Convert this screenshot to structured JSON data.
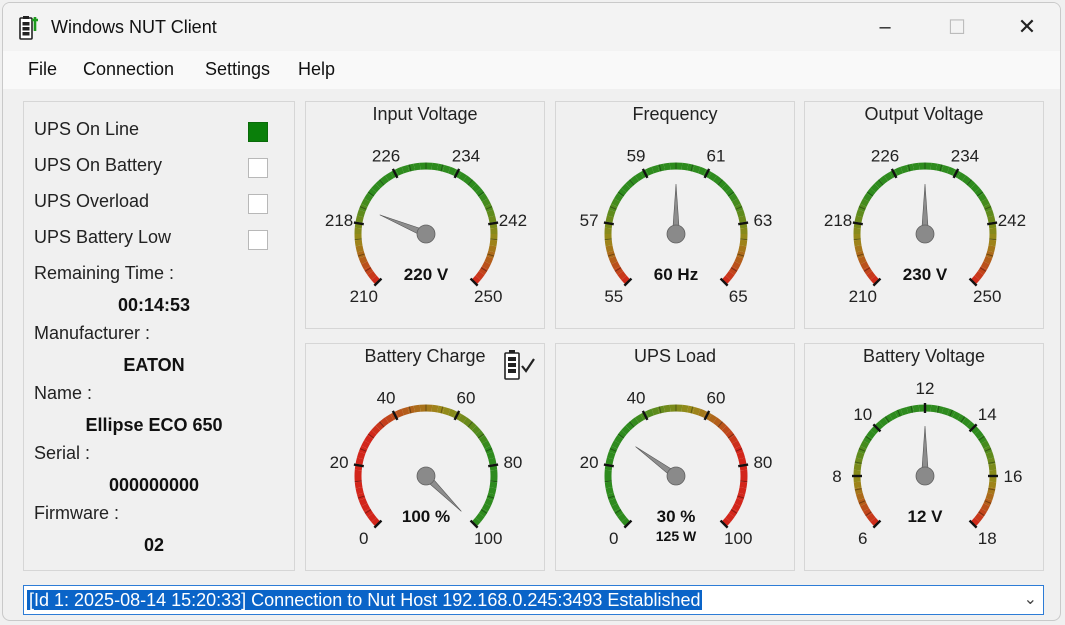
{
  "window": {
    "title": "Windows NUT Client"
  },
  "titlebar": {
    "minimize": "–",
    "maximize": "☐",
    "close": "✕"
  },
  "menu": [
    "File",
    "Connection",
    "Settings",
    "Help"
  ],
  "status": {
    "items": [
      {
        "label": "UPS On Line",
        "on": true
      },
      {
        "label": "UPS On Battery",
        "on": false
      },
      {
        "label": "UPS Overload",
        "on": false
      },
      {
        "label": "UPS Battery Low",
        "on": false
      }
    ]
  },
  "info": {
    "remaining_label": "Remaining Time :",
    "remaining_value": "00:14:53",
    "manufacturer_label": "Manufacturer :",
    "manufacturer_value": "EATON",
    "name_label": "Name :",
    "name_value": "Ellipse ECO 650",
    "serial_label": "Serial :",
    "serial_value": "000000000",
    "firmware_label": "Firmware :",
    "firmware_value": "02"
  },
  "colors": {
    "green": "#2e8b1e",
    "yellow": "#9a8a1a",
    "red": "#d2261b",
    "online": "#0a7f0a"
  },
  "gauges": [
    {
      "id": "input-voltage",
      "title": "Input Voltage",
      "min": 210,
      "max": 250,
      "labels": [
        "210",
        "218",
        "226",
        "234",
        "242",
        "250"
      ],
      "value": 220,
      "readout": "220 V",
      "subreadout": "",
      "zones": "ggr",
      "battery_icon": false
    },
    {
      "id": "frequency",
      "title": "Frequency",
      "min": 55,
      "max": 65,
      "labels": [
        "55",
        "57",
        "59",
        "61",
        "63",
        "65"
      ],
      "value": 60,
      "readout": "60 Hz",
      "subreadout": "",
      "zones": "ggr",
      "battery_icon": false
    },
    {
      "id": "output-voltage",
      "title": "Output Voltage",
      "min": 210,
      "max": 250,
      "labels": [
        "210",
        "218",
        "226",
        "234",
        "242",
        "250"
      ],
      "value": 230,
      "readout": "230 V",
      "subreadout": "",
      "zones": "ggr",
      "battery_icon": false
    },
    {
      "id": "battery-charge",
      "title": "Battery Charge",
      "min": 0,
      "max": 100,
      "labels": [
        "0",
        "20",
        "40",
        "60",
        "80",
        "100"
      ],
      "value": 100,
      "readout": "100 %",
      "subreadout": "",
      "zones": "rg",
      "battery_icon": true
    },
    {
      "id": "ups-load",
      "title": "UPS Load",
      "min": 0,
      "max": 100,
      "labels": [
        "0",
        "20",
        "40",
        "60",
        "80",
        "100"
      ],
      "value": 30,
      "readout": "30 %",
      "subreadout": "125 W",
      "zones": "gr",
      "battery_icon": false
    },
    {
      "id": "battery-voltage",
      "title": "Battery Voltage",
      "min": 6,
      "max": 18,
      "labels": [
        "6",
        "8",
        "10",
        "12",
        "14",
        "16",
        "18"
      ],
      "value": 12,
      "readout": "12 V",
      "subreadout": "",
      "zones": "ggr",
      "battery_icon": false
    }
  ],
  "log": {
    "text": "[Id 1: 2025-08-14 15:20:33] Connection to Nut Host 192.168.0.245:3493 Established"
  }
}
